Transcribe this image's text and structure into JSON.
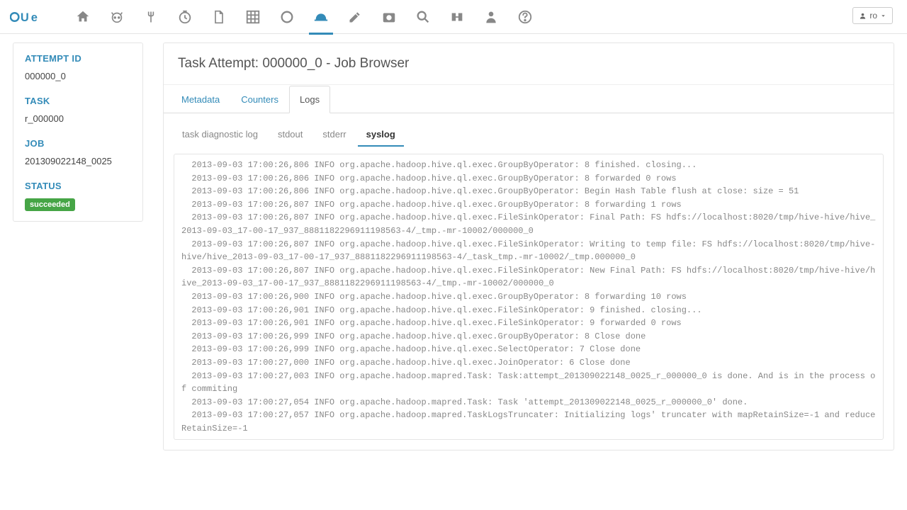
{
  "header": {
    "user_label": "ro"
  },
  "sidebar": {
    "attempt_id_label": "ATTEMPT ID",
    "attempt_id_value": "000000_0",
    "task_label": "TASK",
    "task_value": "r_000000",
    "job_label": "JOB",
    "job_value": "201309022148_0025",
    "status_label": "STATUS",
    "status_value": "succeeded"
  },
  "main": {
    "title": "Task Attempt: 000000_0 - Job Browser",
    "tabs": {
      "metadata": "Metadata",
      "counters": "Counters",
      "logs": "Logs"
    },
    "subtabs": {
      "diag": "task diagnostic log",
      "stdout": "stdout",
      "stderr": "stderr",
      "syslog": "syslog"
    }
  },
  "logs": [
    "  2013-09-03 17:00:26,806 INFO org.apache.hadoop.hive.ql.exec.GroupByOperator: 8 finished. closing...",
    "  2013-09-03 17:00:26,806 INFO org.apache.hadoop.hive.ql.exec.GroupByOperator: 8 forwarded 0 rows",
    "  2013-09-03 17:00:26,806 INFO org.apache.hadoop.hive.ql.exec.GroupByOperator: Begin Hash Table flush at close: size = 51",
    "  2013-09-03 17:00:26,807 INFO org.apache.hadoop.hive.ql.exec.GroupByOperator: 8 forwarding 1 rows",
    "  2013-09-03 17:00:26,807 INFO org.apache.hadoop.hive.ql.exec.FileSinkOperator: Final Path: FS hdfs://localhost:8020/tmp/hive-hive/hive_2013-09-03_17-00-17_937_8881182296911198563-4/_tmp.-mr-10002/000000_0",
    "  2013-09-03 17:00:26,807 INFO org.apache.hadoop.hive.ql.exec.FileSinkOperator: Writing to temp file: FS hdfs://localhost:8020/tmp/hive-hive/hive_2013-09-03_17-00-17_937_8881182296911198563-4/_task_tmp.-mr-10002/_tmp.000000_0",
    "  2013-09-03 17:00:26,807 INFO org.apache.hadoop.hive.ql.exec.FileSinkOperator: New Final Path: FS hdfs://localhost:8020/tmp/hive-hive/hive_2013-09-03_17-00-17_937_8881182296911198563-4/_tmp.-mr-10002/000000_0",
    "  2013-09-03 17:00:26,900 INFO org.apache.hadoop.hive.ql.exec.GroupByOperator: 8 forwarding 10 rows",
    "  2013-09-03 17:00:26,901 INFO org.apache.hadoop.hive.ql.exec.FileSinkOperator: 9 finished. closing...",
    "  2013-09-03 17:00:26,901 INFO org.apache.hadoop.hive.ql.exec.FileSinkOperator: 9 forwarded 0 rows",
    "  2013-09-03 17:00:26,999 INFO org.apache.hadoop.hive.ql.exec.GroupByOperator: 8 Close done",
    "  2013-09-03 17:00:26,999 INFO org.apache.hadoop.hive.ql.exec.SelectOperator: 7 Close done",
    "  2013-09-03 17:00:27,000 INFO org.apache.hadoop.hive.ql.exec.JoinOperator: 6 Close done",
    "  2013-09-03 17:00:27,003 INFO org.apache.hadoop.mapred.Task: Task:attempt_201309022148_0025_r_000000_0 is done. And is in the process of commiting",
    "  2013-09-03 17:00:27,054 INFO org.apache.hadoop.mapred.Task: Task 'attempt_201309022148_0025_r_000000_0' done.",
    "  2013-09-03 17:00:27,057 INFO org.apache.hadoop.mapred.TaskLogsTruncater: Initializing logs' truncater with mapRetainSize=-1 and reduceRetainSize=-1"
  ]
}
